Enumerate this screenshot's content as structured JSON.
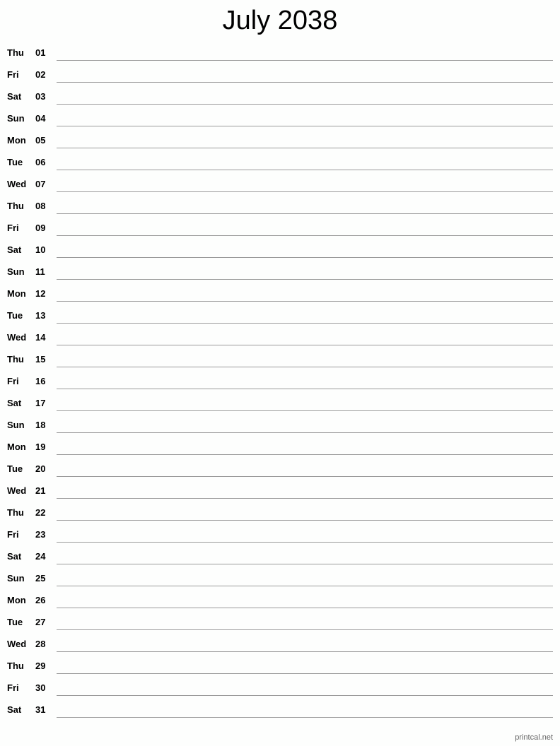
{
  "title": "July 2038",
  "days": [
    {
      "dow": "Thu",
      "num": "01"
    },
    {
      "dow": "Fri",
      "num": "02"
    },
    {
      "dow": "Sat",
      "num": "03"
    },
    {
      "dow": "Sun",
      "num": "04"
    },
    {
      "dow": "Mon",
      "num": "05"
    },
    {
      "dow": "Tue",
      "num": "06"
    },
    {
      "dow": "Wed",
      "num": "07"
    },
    {
      "dow": "Thu",
      "num": "08"
    },
    {
      "dow": "Fri",
      "num": "09"
    },
    {
      "dow": "Sat",
      "num": "10"
    },
    {
      "dow": "Sun",
      "num": "11"
    },
    {
      "dow": "Mon",
      "num": "12"
    },
    {
      "dow": "Tue",
      "num": "13"
    },
    {
      "dow": "Wed",
      "num": "14"
    },
    {
      "dow": "Thu",
      "num": "15"
    },
    {
      "dow": "Fri",
      "num": "16"
    },
    {
      "dow": "Sat",
      "num": "17"
    },
    {
      "dow": "Sun",
      "num": "18"
    },
    {
      "dow": "Mon",
      "num": "19"
    },
    {
      "dow": "Tue",
      "num": "20"
    },
    {
      "dow": "Wed",
      "num": "21"
    },
    {
      "dow": "Thu",
      "num": "22"
    },
    {
      "dow": "Fri",
      "num": "23"
    },
    {
      "dow": "Sat",
      "num": "24"
    },
    {
      "dow": "Sun",
      "num": "25"
    },
    {
      "dow": "Mon",
      "num": "26"
    },
    {
      "dow": "Tue",
      "num": "27"
    },
    {
      "dow": "Wed",
      "num": "28"
    },
    {
      "dow": "Thu",
      "num": "29"
    },
    {
      "dow": "Fri",
      "num": "30"
    },
    {
      "dow": "Sat",
      "num": "31"
    }
  ],
  "footer": "printcal.net"
}
